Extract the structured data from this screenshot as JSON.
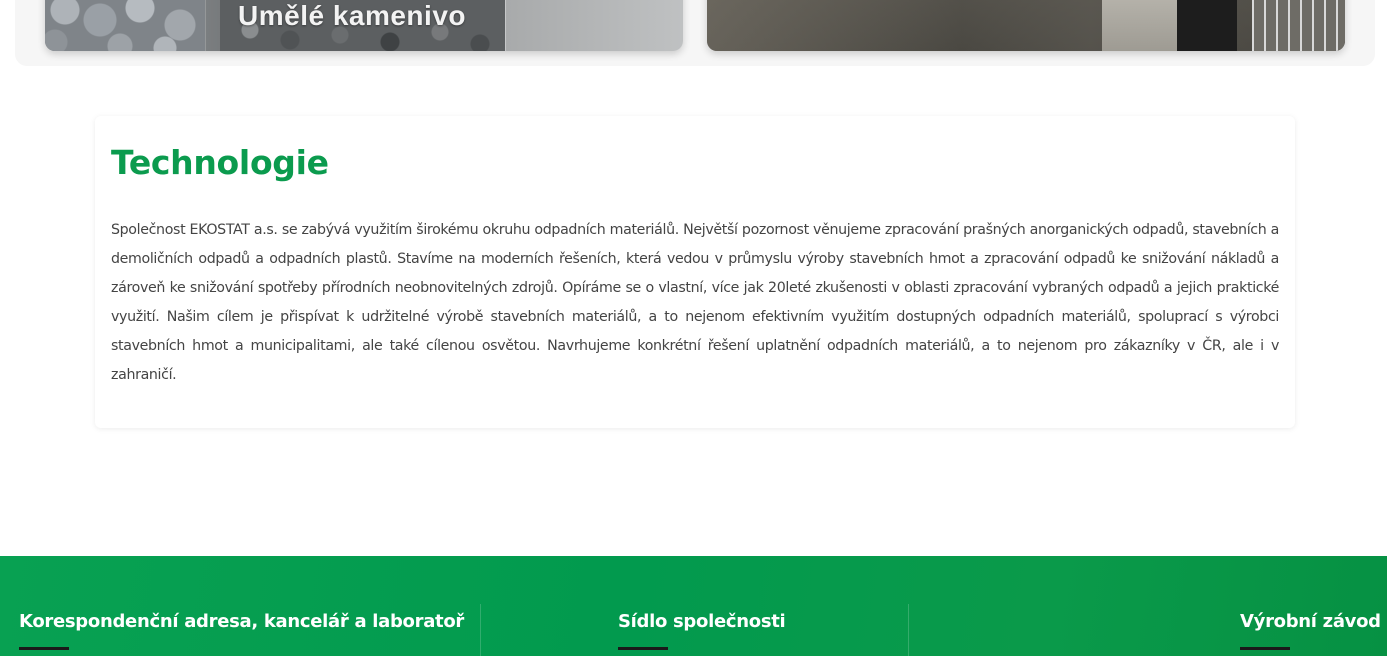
{
  "gallery": {
    "left_card_label": "Umělé kamenivo"
  },
  "technology": {
    "title": "Technologie",
    "text": "Společnost EKOSTAT a.s. se zabývá využitím širokému okruhu odpadních materiálů. Největší pozornost věnujeme zpracování prašných anorganických odpadů, stavebních a demoličních odpadů a odpadních plastů. Stavíme na moderních řešeních, která vedou v průmyslu výroby stavebních hmot a zpracování odpadů ke snižování nákladů a zároveň ke snižování spotřeby přírodních neobnovitelných zdrojů. Opíráme se o vlastní, více jak 20leté zkušenosti v oblasti zpracování vybraných odpadů a jejich praktické využití. Našim cílem je přispívat k udržitelné výrobě stavebních materiálů, a to nejenom efektivním využitím dostupných odpadních materiálů, spoluprací s výrobci stavebních hmot a municipalitami, ale také cílenou osvětou. Navrhujeme konkrétní řešení uplatnění odpadních materiálů, a to nejenom pro zákazníky v ČR, ale i v zahraničí."
  },
  "footer": {
    "col1_heading": "Korespondenční adresa, kancelář a laboratoř",
    "col2_heading": "Sídlo společnosti",
    "col3_heading": "Výrobní závod"
  },
  "colors": {
    "accent_green": "#0b9b4e",
    "footer_green": "#029a4e",
    "body_text": "#444444"
  }
}
